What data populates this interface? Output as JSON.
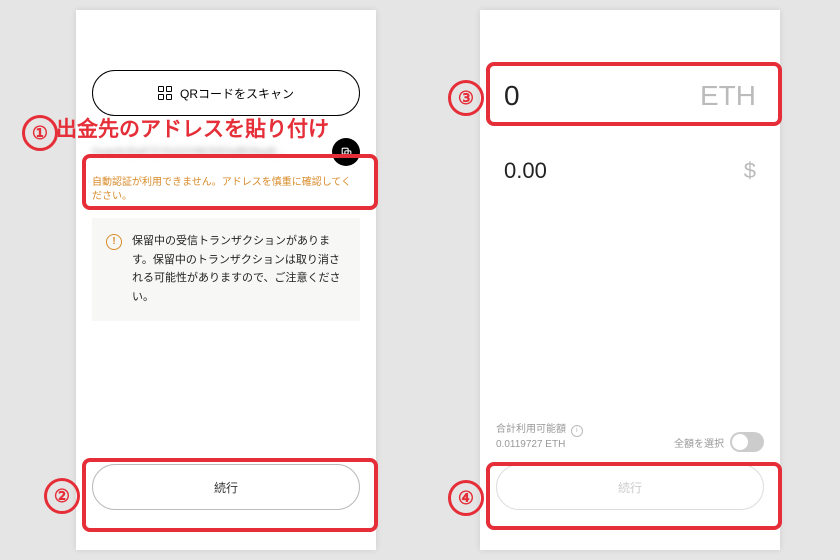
{
  "annotations": {
    "n1": "①",
    "n2": "②",
    "n3": "③",
    "n4": "④",
    "title1": "出金先のアドレスを貼り付け"
  },
  "left": {
    "qr_button": "QRコードをスキャン",
    "address_blur": "0xae9cRa8707b32G9B3583afB0faaB…",
    "warning_text": "自動認証が利用できません。アドレスを慎重に確認してください。",
    "info_text": "保留中の受信トランザクションがあります。保留中のトランザクションは取り消される可能性がありますので、ご注意ください。",
    "continue": "続行"
  },
  "right": {
    "amount": "0",
    "amount_unit": "ETH",
    "fiat": "0.00",
    "fiat_unit": "$",
    "balance_label": "合計利用可能額",
    "balance_value": "0.0119727 ETH",
    "select_all": "全額を選択",
    "continue": "続行"
  }
}
